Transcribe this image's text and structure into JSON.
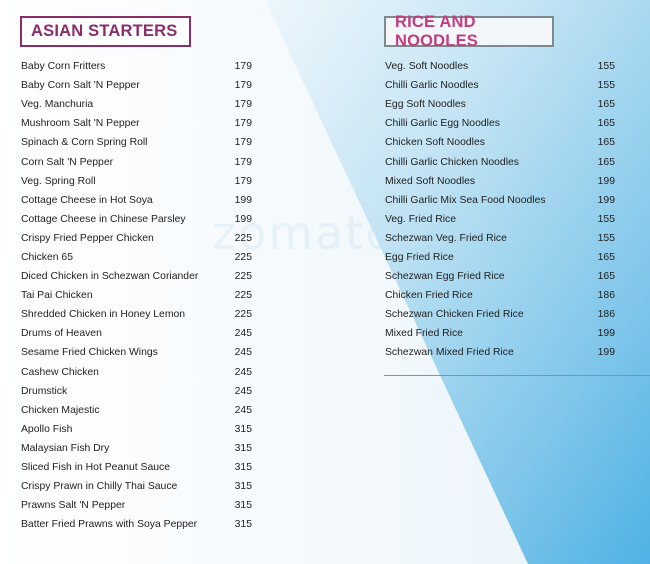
{
  "watermark": "zomato",
  "sections": {
    "left": {
      "title": "ASIAN STARTERS",
      "items": [
        {
          "name": "Baby Corn Fritters",
          "price": "179"
        },
        {
          "name": "Baby Corn Salt 'N Pepper",
          "price": "179"
        },
        {
          "name": "Veg. Manchuria",
          "price": "179"
        },
        {
          "name": "Mushroom Salt 'N Pepper",
          "price": "179"
        },
        {
          "name": "Spinach & Corn Spring Roll",
          "price": "179"
        },
        {
          "name": "Corn Salt 'N Pepper",
          "price": "179"
        },
        {
          "name": "Veg. Spring Roll",
          "price": "179"
        },
        {
          "name": "Cottage Cheese in Hot Soya",
          "price": "199"
        },
        {
          "name": "Cottage Cheese in Chinese Parsley",
          "price": "199"
        },
        {
          "name": "Crispy Fried Pepper Chicken",
          "price": "225"
        },
        {
          "name": "Chicken 65",
          "price": "225"
        },
        {
          "name": "Diced Chicken in Schezwan Coriander",
          "price": "225"
        },
        {
          "name": "Tai Pai Chicken",
          "price": "225"
        },
        {
          "name": "Shredded Chicken in Honey Lemon",
          "price": "225"
        },
        {
          "name": "Drums of Heaven",
          "price": "245"
        },
        {
          "name": "Sesame Fried Chicken Wings",
          "price": "245"
        },
        {
          "name": "Cashew Chicken",
          "price": "245"
        },
        {
          "name": "Drumstick",
          "price": "245"
        },
        {
          "name": "Chicken Majestic",
          "price": "245"
        },
        {
          "name": "Apollo Fish",
          "price": "315"
        },
        {
          "name": "Malaysian Fish Dry",
          "price": "315"
        },
        {
          "name": "Sliced Fish in Hot Peanut Sauce",
          "price": "315"
        },
        {
          "name": "Crispy Prawn in Chilly Thai Sauce",
          "price": "315"
        },
        {
          "name": "Prawns Salt 'N Pepper",
          "price": "315"
        },
        {
          "name": "Batter Fried Prawns with Soya Pepper",
          "price": "315"
        }
      ]
    },
    "right": {
      "title": "RICE AND NOODLES",
      "items": [
        {
          "name": "Veg. Soft Noodles",
          "price": "155"
        },
        {
          "name": "Chilli Garlic Noodles",
          "price": "155"
        },
        {
          "name": "Egg Soft Noodles",
          "price": "165"
        },
        {
          "name": "Chilli Garlic Egg Noodles",
          "price": "165"
        },
        {
          "name": "Chicken Soft Noodles",
          "price": "165"
        },
        {
          "name": "Chilli Garlic Chicken Noodles",
          "price": "165"
        },
        {
          "name": "Mixed Soft Noodles",
          "price": "199"
        },
        {
          "name": "Chilli Garlic Mix Sea Food Noodles",
          "price": "199"
        },
        {
          "name": "Veg. Fried Rice",
          "price": "155"
        },
        {
          "name": "Schezwan Veg. Fried Rice",
          "price": "155"
        },
        {
          "name": "Egg Fried Rice",
          "price": "165"
        },
        {
          "name": "Schezwan Egg Fried Rice",
          "price": "165"
        },
        {
          "name": "Chicken Fried Rice",
          "price": "186"
        },
        {
          "name": "Schezwan Chicken Fried Rice",
          "price": "186"
        },
        {
          "name": "Mixed Fried Rice",
          "price": "199"
        },
        {
          "name": "Schezwan Mixed Fried Rice",
          "price": "199"
        }
      ]
    }
  },
  "colors": {
    "left_heading": "#8a2d6a",
    "right_heading_text": "#c23d80",
    "right_heading_border": "#7d8a90",
    "accent_blue": "#49a8cf"
  }
}
